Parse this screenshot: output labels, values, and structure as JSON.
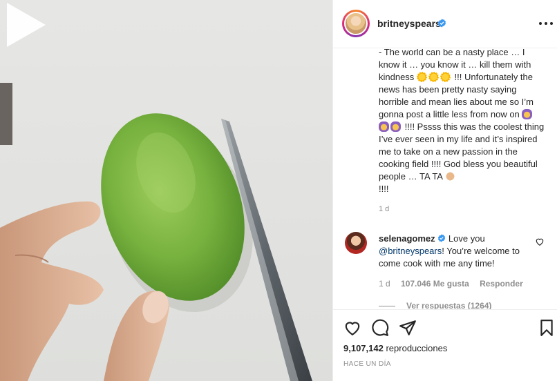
{
  "post": {
    "username": "britneyspears",
    "caption": "- The world can be a nasty place … I know it … you know it … kill them with kindness",
    "caption_2": " !!! Unfortunately the news has been pretty nasty saying horrible and mean lies about me so I’m gonna post a little less from now on ",
    "caption_3": " !!!! Pssss this was the coolest thing I’ve ever seen in my life and it’s inspired me to take on a new passion in the cooking field !!!! God bless you beautiful people … TA TA ",
    "caption_4": "!!!!",
    "caption_time": "1 d"
  },
  "comment": {
    "username": "selenagomez",
    "text_1": "Love you ",
    "mention": "@britneyspears",
    "text_2": "! You’re welcome to come cook with me any time!",
    "time": "1 d",
    "likes": "107.046 Me gusta",
    "reply": "Responder",
    "view_replies": "Ver respuestas (1264)"
  },
  "footer": {
    "views_count": "9,107,142",
    "views_label": "reproducciones",
    "date": "HACE UN DÍA"
  },
  "icons": {
    "play": "play-icon",
    "verified": "verified-badge-icon",
    "more": "more-options-icon",
    "heart": "heart-icon",
    "comment": "comment-icon",
    "share": "share-icon",
    "save": "bookmark-icon"
  },
  "colors": {
    "verified": "#3897f0",
    "link": "#00376b",
    "secondary_text": "#8e8e8e"
  }
}
